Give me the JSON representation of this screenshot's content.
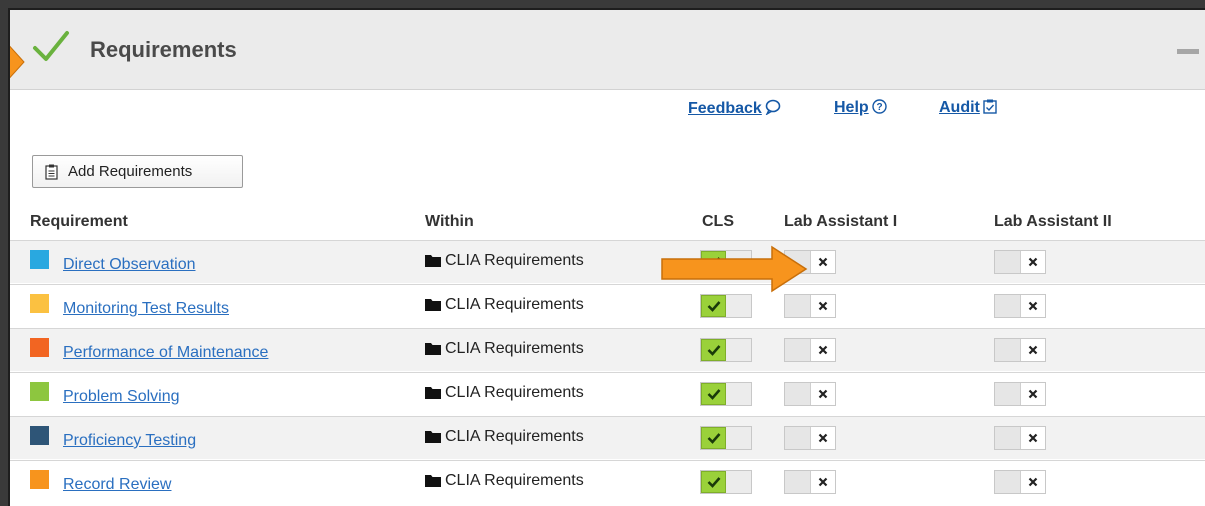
{
  "panel": {
    "title": "Requirements"
  },
  "links": {
    "feedback": "Feedback",
    "help": "Help",
    "audit": "Audit"
  },
  "add_button": {
    "label": "Add Requirements"
  },
  "columns": {
    "requirement": "Requirement",
    "within": "Within",
    "cls": "CLS",
    "lab_assistant_1": "Lab Assistant I",
    "lab_assistant_2": "Lab Assistant II"
  },
  "rows": [
    {
      "name": "Direct Observation",
      "color": "#29a8e0",
      "within": "CLIA Requirements",
      "cls": true,
      "la1": false,
      "la2": false
    },
    {
      "name": "Monitoring Test Results",
      "color": "#fbc141",
      "within": "CLIA Requirements",
      "cls": true,
      "la1": false,
      "la2": false
    },
    {
      "name": "Performance of Maintenance",
      "color": "#f26522",
      "within": "CLIA Requirements",
      "cls": true,
      "la1": false,
      "la2": false
    },
    {
      "name": "Problem Solving",
      "color": "#8dc63f",
      "within": "CLIA Requirements",
      "cls": true,
      "la1": false,
      "la2": false
    },
    {
      "name": "Proficiency Testing",
      "color": "#2e5577",
      "within": "CLIA Requirements",
      "cls": true,
      "la1": false,
      "la2": false
    },
    {
      "name": "Record Review",
      "color": "#f7941d",
      "within": "CLIA Requirements",
      "cls": true,
      "la1": false,
      "la2": false
    }
  ],
  "colors": {
    "accent_green": "#9ad13a",
    "link_blue": "#2a6fc0",
    "arrow_orange": "#f7941d"
  },
  "icons": [
    "check-icon",
    "feedback-icon",
    "help-icon",
    "audit-icon",
    "clipboard-icon",
    "folder-icon",
    "collapse-icon",
    "arrow-icon"
  ]
}
